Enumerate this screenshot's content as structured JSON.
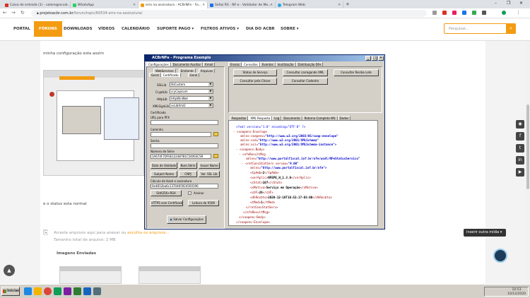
{
  "browser": {
    "tabs": [
      {
        "title": "Caixa de entrada (1) - valere@ecvc...",
        "color": "#d93025"
      },
      {
        "title": "WhatsApp",
        "color": "#25d366"
      },
      {
        "title": "erro na assinatura - ACBrNFe - Fo...",
        "color": "#f39c12"
      },
      {
        "title": "Sefaz RS - NF-e - Validador de Me...",
        "color": "#1a73e8"
      },
      {
        "title": "Telegram Web",
        "color": "#2ca5e0"
      }
    ],
    "url_host": "projetoacbr.com.br",
    "url_path": "/forum/topic/60534-erro-na-assinatura/"
  },
  "site_nav": {
    "items": [
      "PORTAL",
      "FÓRUNS",
      "DOWNLOADS",
      "VÍDEOS",
      "CALENDÁRIO",
      "SUPORTE PAGO ▾",
      "FILTROS ATIVOS ▾",
      "DIA DO ACBR",
      "SOBRE ▾"
    ],
    "search_placeholder": "Pesquisar..."
  },
  "post": {
    "line1": "minha configuração esta assim",
    "line2": "e o status esta normal",
    "attach_hint": "Arraste arquivos aqui para anexar ou",
    "attach_link": "escolha os arquivos...",
    "attach_size": "Tamanho total de arquivo: 2 MB",
    "images_label": "Imagens Enviadas",
    "insert_menu": "Inserir outra mídia ▾"
  },
  "app": {
    "title": "ACBrNFe - Programa Exemplo",
    "left_tabs": [
      "Configurações",
      "Documento Auxiliar",
      "Email"
    ],
    "left_subtabs": [
      "WebServices",
      "Emitente",
      "Arquivos"
    ],
    "left_subtabs2": [
      "Geral",
      "Certificado",
      "Geral"
    ],
    "ssl_label": "SSLLib",
    "ssl_value": "libCustom",
    "crypt_label": "CryptLib",
    "crypt_value": "cryCapicom",
    "http_label": "HttpLib",
    "http_value": "httpWinINet",
    "xmlsign_label": "XMLSignLib",
    "xmlsign_value": "xsLibXml2",
    "cert_label": "Certificado",
    "url_pfx_label": "URL para PFX",
    "caminho_label": "Caminho",
    "senha_label": "Senha",
    "serie_label": "Número de Série",
    "serie_value": "1A674F7DF6E122487B1C54063CS9",
    "btn_validade": "Data de Validade",
    "btn_numserie": "Num.Série",
    "btn_issuer": "Issuer Name",
    "btn_subject": "Subject Name",
    "btn_cnpj": "CNPJ",
    "btn_verssl": "Ver. SSL Lib",
    "hash_label": "Cálculo de Hash e assinatura",
    "hash_value": "0e4812ba6c1370465924500196",
    "btn_sha": "SHA256+RSA",
    "chk_assinar": "Assinar",
    "btn_https": "HTTPS sem Certificado",
    "btn_leitura": "Leitura de X509",
    "btn_salvar": "Salvar Configurações",
    "right_tabs": [
      "Envios",
      "Consultas",
      "Eventos",
      "Inutilização",
      "Distribuição DFe"
    ],
    "btn_status": "Status de Serviço",
    "btn_consultar_xml": "Consultar carregando XML",
    "btn_recibo": "Consultar Recibo Lote",
    "btn_chave": "Consultar pela Chave",
    "btn_cadastro": "Consultar Cadastro",
    "result_tabs": [
      "Respostas",
      "XML Resposta",
      "Log",
      "Documento",
      "Retorno Completo WS",
      "Dados"
    ],
    "xml": {
      "pi": "<?xml version=\"1.0\" encoding=\"UTF-8\" ?>",
      "envelope": "<soapenv:Envelope",
      "ns1_attr": "xmlns:soapenv=",
      "ns1_val": "\"http://www.w3.org/2003/05/soap-envelope\"",
      "ns2_attr": "xmlns:xsd=",
      "ns2_val": "\"http://www.w3.org/2001/XMLSchema\"",
      "ns3_attr": "xmlns:xsi=",
      "ns3_val": "\"http://www.w3.org/2001/XMLSchema-instance\">",
      "body": "<soapenv:Body>",
      "nfe_result": "<nfeResultMsg",
      "nfe_ns_attr": "xmlns=",
      "nfe_ns_val": "\"http://www.portalfiscal.inf.br/nfe/wsdl/NFeStatusServico\"",
      "ret_open": "<retConsStatServ versao=",
      "ret_ver": "\"4.00\"",
      "ret_ns_attr": "xmlns=",
      "ret_ns_val": "\"http://www.portalfiscal.inf.br/nfe\">",
      "tpamb": "<tpAmb>",
      "tpamb_v": "2",
      "tpamb_c": "</tpAmb>",
      "veraplic": "<verAplic>",
      "veraplic_v": "NFEPE_H_1.3.0",
      "veraplic_c": "</verAplic>",
      "cstat": "<cStat>",
      "cstat_v": "107",
      "cstat_c": "</cStat>",
      "xmotivo": "<xMotivo>",
      "xmotivo_v": "Serviço em Operação",
      "xmotivo_c": "</xMotivo>",
      "cuf": "<cUF>",
      "cuf_v": "26",
      "cuf_c": "</cUF>",
      "dhrecbto": "<dhRecbto>",
      "dhrecbto_v": "2020-12-10T10:52:17-03:00",
      "dhrecbto_c": "</dhRecbto>",
      "tmed": "<tMed>",
      "tmed_v": "1",
      "tmed_c": "</tMed>",
      "ret_close": "</retConsStatServ>",
      "nfe_close": "</nfeResultMsg>",
      "body_close": "</soapenv:Body>",
      "env_close": "</soapenv:Envelope>"
    }
  },
  "taskbar": {
    "start": "Iniciar",
    "time": "10:53",
    "date": "10/12/2020"
  }
}
